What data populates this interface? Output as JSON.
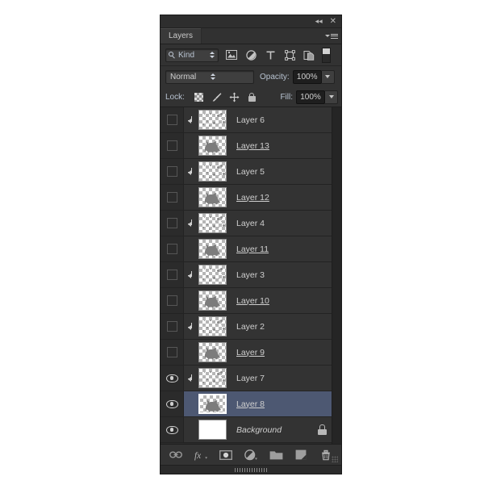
{
  "panel": {
    "titlebar": {
      "collapse_icon": "collapse-arrows",
      "close_icon": "close-x"
    },
    "tab": {
      "label": "Layers"
    },
    "menu_icon": "panel-menu-icon"
  },
  "filter": {
    "kind_label": "Kind",
    "search_icon": "search-icon",
    "icons": [
      {
        "name": "filter-pixel-layers",
        "label": "Pixel"
      },
      {
        "name": "filter-adjustment-layers",
        "label": "Adjustment"
      },
      {
        "name": "filter-type-layers",
        "label": "T"
      },
      {
        "name": "filter-shape-layers",
        "label": "Shape"
      },
      {
        "name": "filter-smart-object-layers",
        "label": "Smart Object"
      }
    ],
    "toggle_name": "filter-enable-toggle"
  },
  "options": {
    "blend_mode": "Normal",
    "opacity_label": "Opacity:",
    "opacity_value": "100%",
    "fill_label": "Fill:",
    "fill_value": "100%",
    "lock_label": "Lock:",
    "lock_icons": [
      {
        "name": "lock-transparent-pixels"
      },
      {
        "name": "lock-image-pixels"
      },
      {
        "name": "lock-position"
      },
      {
        "name": "lock-all"
      }
    ]
  },
  "layers": [
    {
      "name": "Layer 6",
      "visible": false,
      "clipped": true,
      "selected": false,
      "underline": false,
      "italic": false,
      "locked": false,
      "thumb": "dots"
    },
    {
      "name": "Layer 13 ",
      "visible": false,
      "clipped": false,
      "selected": false,
      "underline": true,
      "italic": false,
      "locked": false,
      "thumb": "cat"
    },
    {
      "name": "Layer 5",
      "visible": false,
      "clipped": true,
      "selected": false,
      "underline": false,
      "italic": false,
      "locked": false,
      "thumb": "dots"
    },
    {
      "name": "Layer 12 ",
      "visible": false,
      "clipped": false,
      "selected": false,
      "underline": true,
      "italic": false,
      "locked": false,
      "thumb": "cat"
    },
    {
      "name": "Layer 4",
      "visible": false,
      "clipped": true,
      "selected": false,
      "underline": false,
      "italic": false,
      "locked": false,
      "thumb": "dots"
    },
    {
      "name": "Layer 11 ",
      "visible": false,
      "clipped": false,
      "selected": false,
      "underline": true,
      "italic": false,
      "locked": false,
      "thumb": "cat"
    },
    {
      "name": "Layer 3",
      "visible": false,
      "clipped": true,
      "selected": false,
      "underline": false,
      "italic": false,
      "locked": false,
      "thumb": "dots"
    },
    {
      "name": "Layer 10 ",
      "visible": false,
      "clipped": false,
      "selected": false,
      "underline": true,
      "italic": false,
      "locked": false,
      "thumb": "cat"
    },
    {
      "name": "Layer 2",
      "visible": false,
      "clipped": true,
      "selected": false,
      "underline": false,
      "italic": false,
      "locked": false,
      "thumb": "dots"
    },
    {
      "name": "Layer 9 ",
      "visible": false,
      "clipped": false,
      "selected": false,
      "underline": true,
      "italic": false,
      "locked": false,
      "thumb": "cat"
    },
    {
      "name": "Layer 7",
      "visible": true,
      "clipped": true,
      "selected": false,
      "underline": false,
      "italic": false,
      "locked": false,
      "thumb": "dots"
    },
    {
      "name": "Layer 8 ",
      "visible": true,
      "clipped": false,
      "selected": true,
      "underline": true,
      "italic": false,
      "locked": false,
      "thumb": "cat"
    },
    {
      "name": "Background",
      "visible": true,
      "clipped": false,
      "selected": false,
      "underline": false,
      "italic": true,
      "locked": true,
      "thumb": "white"
    }
  ],
  "bottom_bar": {
    "buttons": [
      {
        "name": "link-layers-button",
        "label": "Link layers"
      },
      {
        "name": "layer-style-fx-button",
        "label": "fx"
      },
      {
        "name": "add-layer-mask-button",
        "label": "Add layer mask"
      },
      {
        "name": "new-adjustment-layer-button",
        "label": "New fill or adjustment layer"
      },
      {
        "name": "new-group-button",
        "label": "Create a new group"
      },
      {
        "name": "new-layer-button",
        "label": "Create a new layer"
      },
      {
        "name": "delete-layer-button",
        "label": "Delete layer"
      }
    ]
  },
  "colors": {
    "panel_bg": "#2b2b2b",
    "row_bg": "#333333",
    "selected_row": "#4d5872",
    "text": "#cfcfcf",
    "accent_text": "#b9c4d2"
  }
}
